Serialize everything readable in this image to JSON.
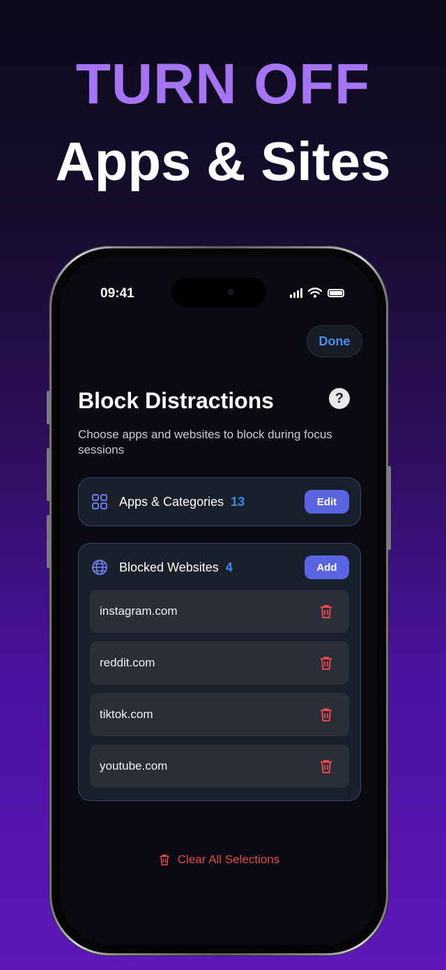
{
  "hero": {
    "line1": "TURN OFF",
    "line2": "Apps & Sites"
  },
  "status_bar": {
    "time": "09:41",
    "icons": [
      "signal-icon",
      "wifi-icon",
      "battery-icon"
    ]
  },
  "header": {
    "done_label": "Done",
    "help_label": "?"
  },
  "page": {
    "title": "Block Distractions",
    "subtitle": "Choose apps and websites to block during focus sessions"
  },
  "apps_card": {
    "icon": "grid-icon",
    "label": "Apps & Categories",
    "count": "13",
    "button_label": "Edit"
  },
  "websites_card": {
    "icon": "globe-icon",
    "label": "Blocked Websites",
    "count": "4",
    "button_label": "Add",
    "sites": [
      {
        "domain": "instagram.com"
      },
      {
        "domain": "reddit.com"
      },
      {
        "domain": "tiktok.com"
      },
      {
        "domain": "youtube.com"
      }
    ]
  },
  "footer": {
    "clear_label": "Clear All Selections"
  },
  "colors": {
    "accent_purple": "#a574f0",
    "accent_blue": "#3b8af0",
    "button_indigo": "#5a64e0",
    "danger_red": "#e5484d"
  }
}
